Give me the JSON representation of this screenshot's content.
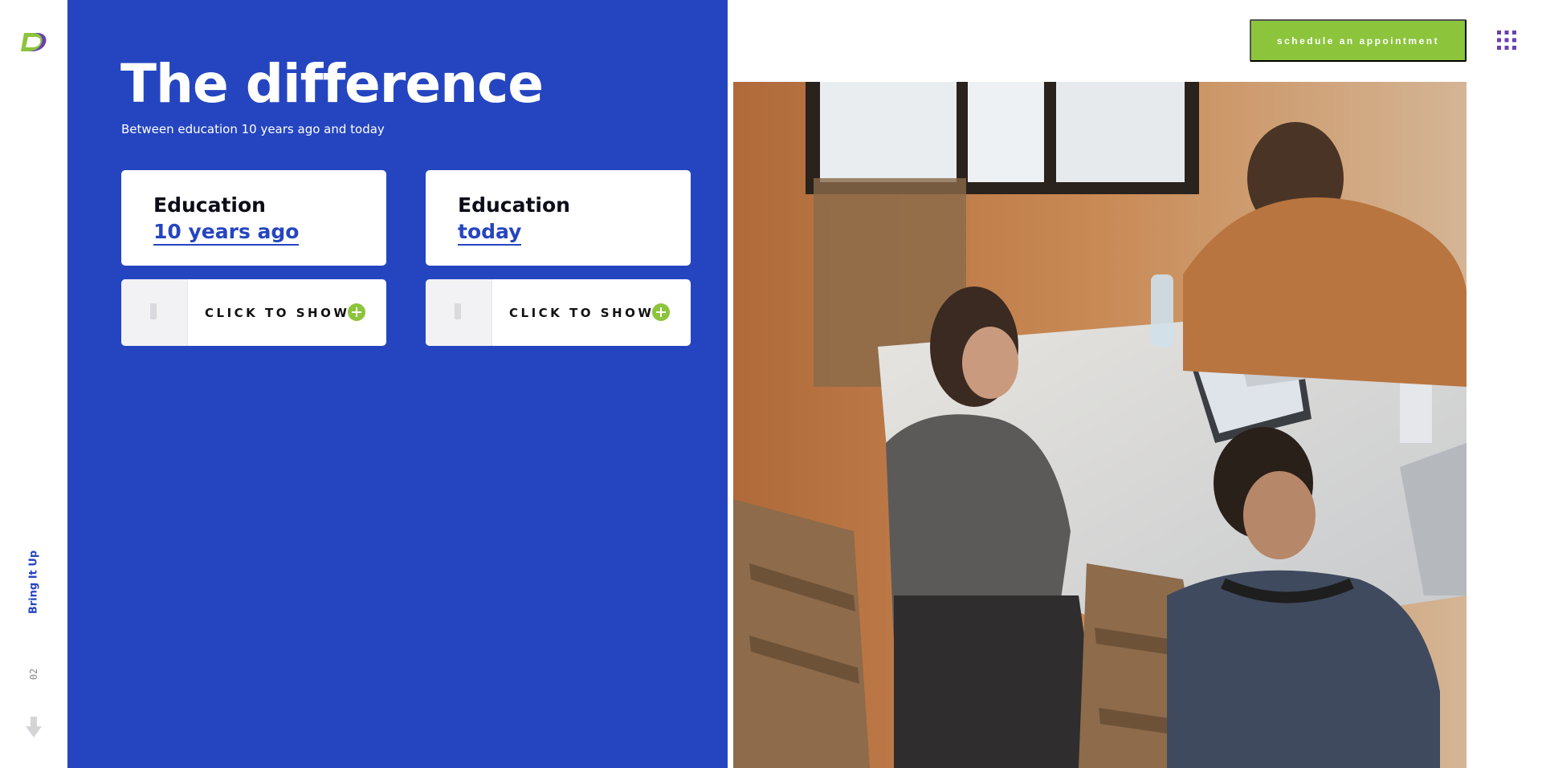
{
  "brand": {
    "name": "Bring It Up"
  },
  "colors": {
    "blue": "#2545c0",
    "green": "#8cc43c",
    "white": "#ffffff",
    "dark": "#0d0d1a"
  },
  "header": {
    "cta_label": "schedule an appointment",
    "menu_icon": "grid-menu-icon"
  },
  "sidebar": {
    "label": "Bring It Up",
    "page": "02",
    "scroll_icon": "arrow-down-icon"
  },
  "hero": {
    "title": "The difference",
    "subtitle": "Between education 10 years ago and today"
  },
  "cards": [
    {
      "heading": "Education",
      "link": "10 years ago",
      "reveal_label": "CLICK TO SHOW"
    },
    {
      "heading": "Education",
      "link": "today",
      "reveal_label": "CLICK TO SHOW"
    }
  ]
}
